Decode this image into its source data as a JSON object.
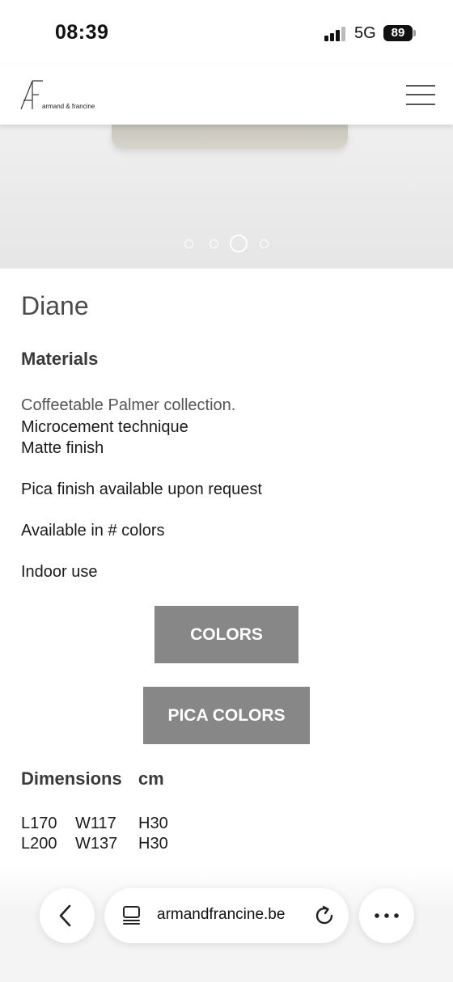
{
  "status_bar": {
    "time": "08:39",
    "network": "5G",
    "battery": "89"
  },
  "header": {
    "logo_text": "armand & francine"
  },
  "carousel": {
    "slide_count": 4,
    "active_index": 2
  },
  "product": {
    "title": "Diane",
    "materials_heading": "Materials",
    "description_lines": [
      "Coffeetable Palmer collection.",
      "Microcement technique",
      "Matte finish",
      "Pica finish available upon request",
      "Available in # colors",
      "Indoor use"
    ],
    "buttons": {
      "colors": "COLORS",
      "pica_colors": "PICA COLORS"
    },
    "dimensions_heading": "Dimensions",
    "dimensions_unit": "cm",
    "dimensions": [
      {
        "l": "L170",
        "w": "W117",
        "h": "H30"
      },
      {
        "l": "L200",
        "w": "W137",
        "h": "H30"
      }
    ]
  },
  "browser": {
    "url": "armandfrancine.be",
    "icons": [
      "back-arrow-icon",
      "tabs-icon",
      "reload-icon",
      "more-dots-icon"
    ]
  }
}
